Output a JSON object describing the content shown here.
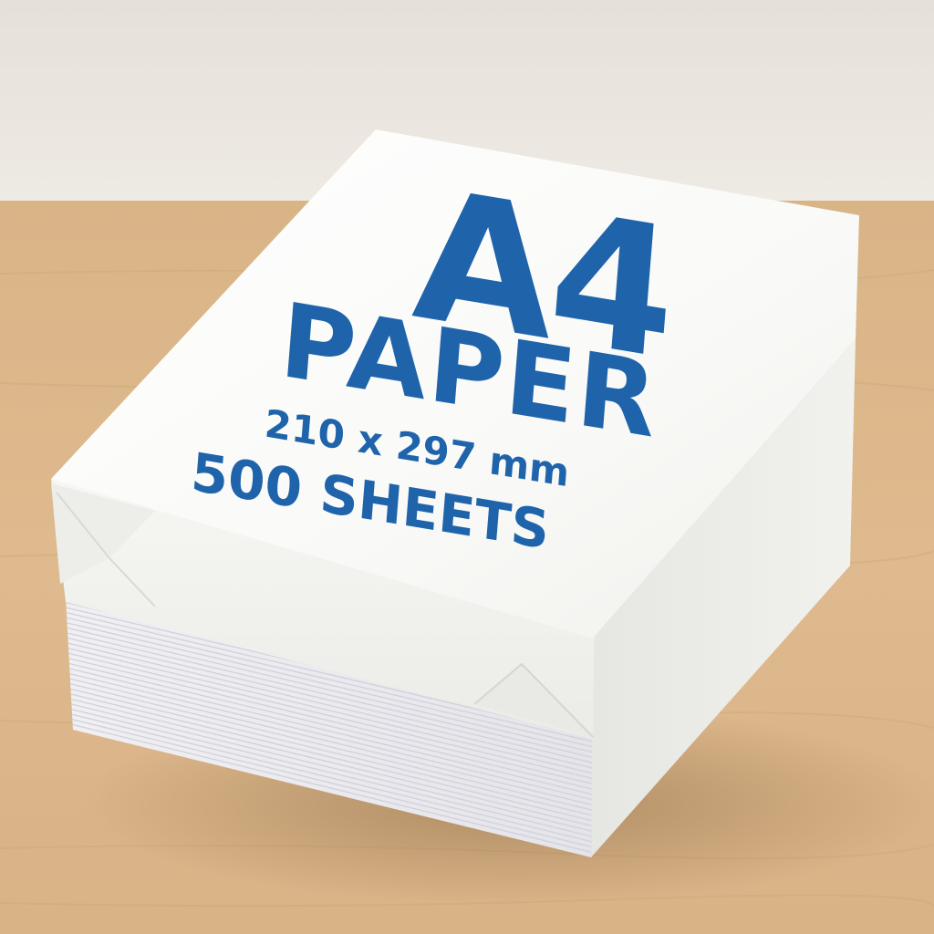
{
  "product": {
    "size_name": "A4",
    "type_name": "PAPER",
    "dimensions": "210 x 297 mm",
    "sheet_count": "500 SHEETS"
  },
  "colors": {
    "print_blue": "#1f64ab",
    "wall": "#ebe6df",
    "table": "#dcb88c",
    "wrapper": "#fbfbf9",
    "sheets": "#f4f4f6"
  }
}
